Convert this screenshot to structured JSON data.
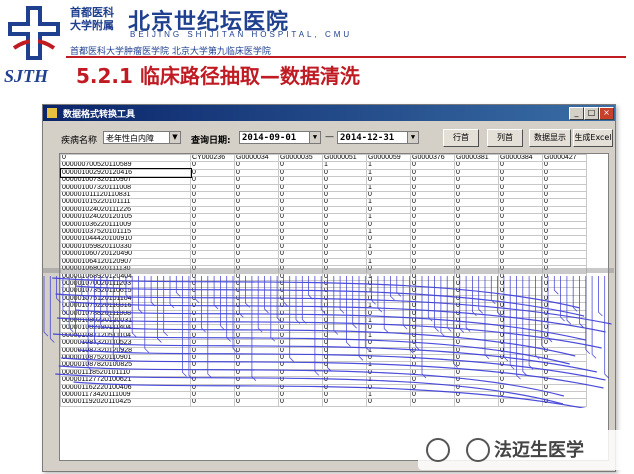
{
  "slide": {
    "hospital_small_cn_line1": "首都医科",
    "hospital_small_cn_line2": "大学附属",
    "hospital_big_cn": "北京世纪坛医院",
    "hospital_en": "BEIJING SHIJITAN HOSPITAL, CMU",
    "hospital_sub": "首都医科大学肿瘤医学院   北京大学第九临床医学院",
    "abbrev": "SJTH",
    "title": "5.2.1  临床路径抽取—数据清洗"
  },
  "window": {
    "title": "数据格式转换工具",
    "controls": [
      "_",
      "□",
      "×"
    ]
  },
  "toolbar": {
    "name_label": "疾病名称",
    "name_value": "老年性白内障",
    "date_label": "查询日期:",
    "date_from": "2014-09-01",
    "date_sep": "—",
    "date_to": "2014-12-31",
    "btn_row": "行首",
    "btn_col": "列首",
    "btn_show": "数据显示",
    "btn_excel": "生成Excel"
  },
  "grid": {
    "columns": [
      "0",
      "CY000236",
      "G0000034",
      "G0000035",
      "G0000051",
      "G0000059",
      "G0000376",
      "G0000381",
      "G0000384",
      "G0000427"
    ],
    "rows": [
      [
        "000000700520110589",
        "0",
        "0",
        "0",
        "1",
        "1",
        "0",
        "0",
        "0",
        "0"
      ],
      [
        "000001002920120416",
        "0",
        "0",
        "0",
        "0",
        "1",
        "0",
        "0",
        "0",
        "0"
      ],
      [
        "000001007320110907",
        "0",
        "0",
        "0",
        "0",
        "0",
        "0",
        "0",
        "0",
        "0"
      ],
      [
        "000001007320111008",
        "0",
        "0",
        "0",
        "0",
        "1",
        "0",
        "0",
        "0",
        "0"
      ],
      [
        "000001011120110831",
        "0",
        "0",
        "0",
        "0",
        "0",
        "0",
        "0",
        "0",
        "0"
      ],
      [
        "000001015220101111",
        "0",
        "0",
        "0",
        "0",
        "1",
        "0",
        "0",
        "0",
        "0"
      ],
      [
        "000001024020111226",
        "0",
        "0",
        "0",
        "0",
        "0",
        "0",
        "0",
        "0",
        "0"
      ],
      [
        "000001024020120105",
        "0",
        "0",
        "0",
        "0",
        "1",
        "0",
        "0",
        "0",
        "0"
      ],
      [
        "000001036220111009",
        "0",
        "0",
        "0",
        "0",
        "0",
        "0",
        "0",
        "0",
        "0"
      ],
      [
        "000001037520101115",
        "0",
        "0",
        "0",
        "0",
        "1",
        "0",
        "0",
        "0",
        "0"
      ],
      [
        "000001044420100910",
        "0",
        "0",
        "0",
        "0",
        "0",
        "0",
        "0",
        "0",
        "0"
      ],
      [
        "000001059820110330",
        "0",
        "0",
        "0",
        "0",
        "1",
        "0",
        "0",
        "0",
        "0"
      ],
      [
        "000001060720120490",
        "0",
        "0",
        "0",
        "0",
        "0",
        "0",
        "0",
        "0",
        "0"
      ],
      [
        "000001064120120907",
        "0",
        "0",
        "0",
        "0",
        "1",
        "0",
        "0",
        "0",
        "0"
      ],
      [
        "000001068020111130",
        "0",
        "0",
        "0",
        "0",
        "0",
        "0",
        "0",
        "0",
        "0"
      ],
      [
        "000001068920120404",
        "0",
        "0",
        "0",
        "0",
        "1",
        "0",
        "0",
        "0",
        "0"
      ],
      [
        "000001070020111203",
        "0",
        "0",
        "0",
        "0",
        "0",
        "0",
        "0",
        "0",
        "0"
      ],
      [
        "000001073520110615",
        "0",
        "0",
        "0",
        "0",
        "1",
        "0",
        "0",
        "0",
        "0"
      ],
      [
        "000001075120101104",
        "0",
        "0",
        "0",
        "0",
        "0",
        "0",
        "0",
        "0",
        "0"
      ],
      [
        "000001075220110316",
        "0",
        "0",
        "0",
        "0",
        "1",
        "0",
        "0",
        "0",
        "0"
      ],
      [
        "000001078820111008",
        "0",
        "0",
        "0",
        "0",
        "0",
        "0",
        "0",
        "0",
        "0"
      ],
      [
        "000001080220120031",
        "0",
        "0",
        "0",
        "0",
        "1",
        "0",
        "0",
        "0",
        "0"
      ],
      [
        "000001082120111404",
        "0",
        "0",
        "0",
        "0",
        "0",
        "0",
        "0",
        "0",
        "0"
      ],
      [
        "000001087120511104",
        "0",
        "0",
        "0",
        "0",
        "1",
        "0",
        "0",
        "0",
        "0"
      ],
      [
        "000001087320110523",
        "0",
        "0",
        "0",
        "0",
        "0",
        "0",
        "0",
        "0",
        "0"
      ],
      [
        "000001087320120928",
        "0",
        "0",
        "0",
        "0",
        "1",
        "0",
        "0",
        "0",
        "0"
      ],
      [
        "000001087520110901",
        "0",
        "0",
        "0",
        "0",
        "0",
        "0",
        "0",
        "0",
        "0"
      ],
      [
        "000001087820100825",
        "0",
        "0",
        "0",
        "0",
        "1",
        "0",
        "0",
        "0",
        "0"
      ],
      [
        "000001118520101110",
        "0",
        "0",
        "0",
        "0",
        "0",
        "0",
        "0",
        "0",
        "0"
      ],
      [
        "000001127720100621",
        "0",
        "0",
        "0",
        "0",
        "1",
        "0",
        "0",
        "0",
        "0"
      ],
      [
        "000001162220100406",
        "0",
        "0",
        "0",
        "0",
        "0",
        "0",
        "0",
        "0",
        "0"
      ],
      [
        "000001173420111009",
        "0",
        "0",
        "0",
        "0",
        "1",
        "0",
        "0",
        "0",
        "0"
      ],
      [
        "000001192020110425",
        "0",
        "0",
        "0",
        "0",
        "0",
        "0",
        "0",
        "0",
        "0"
      ]
    ]
  },
  "watermark": {
    "text": "法迈生医学"
  },
  "colors": {
    "title_red": "#c01b23",
    "brand_blue": "#1f3f8f",
    "scribble_blue": "#3a3ad8"
  }
}
